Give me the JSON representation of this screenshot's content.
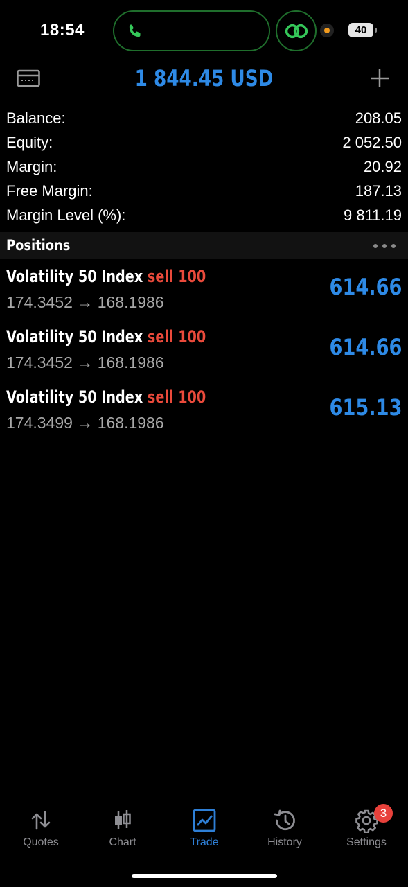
{
  "status": {
    "time": "18:54",
    "battery": "40"
  },
  "header": {
    "title": "1 844.45 USD"
  },
  "account": [
    {
      "label": "Balance:",
      "value": "208.05"
    },
    {
      "label": "Equity:",
      "value": "2 052.50"
    },
    {
      "label": "Margin:",
      "value": "20.92"
    },
    {
      "label": "Free Margin:",
      "value": "187.13"
    },
    {
      "label": "Margin Level (%):",
      "value": "9 811.19"
    }
  ],
  "positions_header": "Positions",
  "positions": [
    {
      "symbol": "Volatility 50 Index",
      "side": "sell 100",
      "prices": "174.3452 → 168.1986",
      "profit": "614.66"
    },
    {
      "symbol": "Volatility 50 Index",
      "side": "sell 100",
      "prices": "174.3452 → 168.1986",
      "profit": "614.66"
    },
    {
      "symbol": "Volatility 50 Index",
      "side": "sell 100",
      "prices": "174.3499 → 168.1986",
      "profit": "615.13"
    }
  ],
  "tabs": [
    {
      "label": "Quotes",
      "icon": "quotes-icon"
    },
    {
      "label": "Chart",
      "icon": "chart-icon"
    },
    {
      "label": "Trade",
      "icon": "trade-icon"
    },
    {
      "label": "History",
      "icon": "history-icon"
    },
    {
      "label": "Settings",
      "icon": "settings-icon"
    }
  ],
  "settings_badge": "3",
  "colors": {
    "accent": "#2e8ae6",
    "sell": "#ea4a3b",
    "island_border": "#1f6e2c"
  }
}
